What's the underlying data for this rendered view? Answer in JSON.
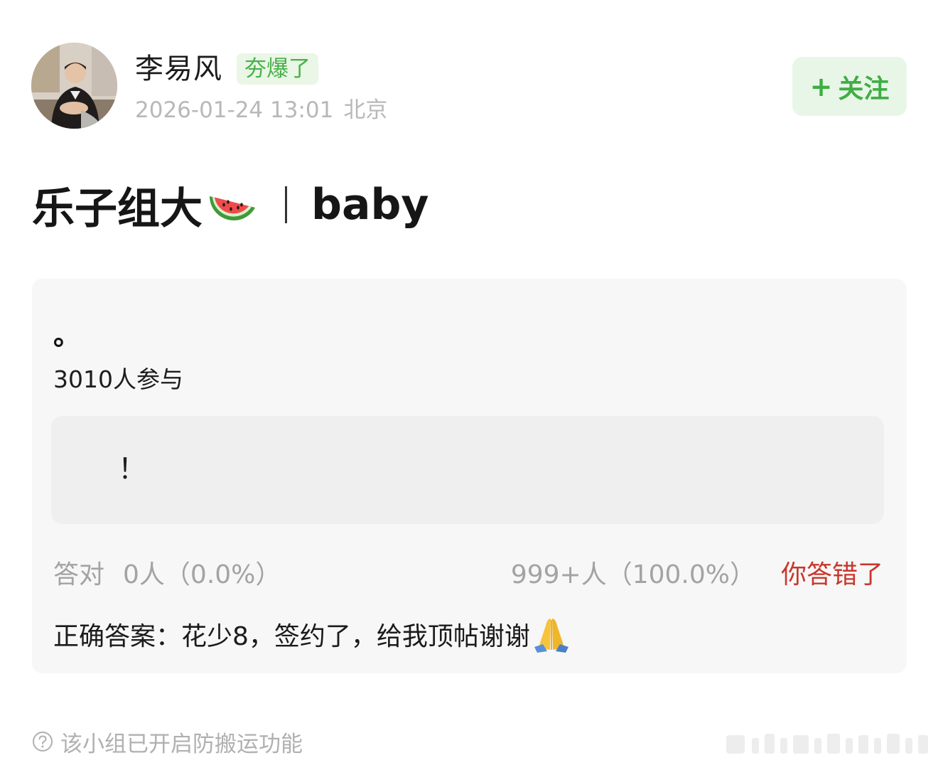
{
  "header": {
    "username": "李易风",
    "badge": "夯爆了",
    "date": "2026-01-24 13:01",
    "location": "北京",
    "follow_label": "关注",
    "follow_plus": "+"
  },
  "post": {
    "title_text": "乐子组大",
    "title_emoji": "watermelon-emoji",
    "title_suffix": "baby"
  },
  "quiz": {
    "question": "。",
    "participants": "3010人参与",
    "option": "！",
    "correct_label": "答对",
    "correct_count": "0人（0.0%）",
    "wrong_count": "999+人（100.0%）",
    "wrong_label": "你答错了",
    "answer": "正确答案：花少8，签约了，给我顶帖谢谢",
    "answer_emoji": "folded-hands-emoji"
  },
  "footer": {
    "note": "该小组已开启防搬运功能",
    "icon": "question-circle-icon"
  },
  "colors": {
    "accent_green": "#47b14a",
    "badge_bg": "#eaf6e6",
    "wrong_red": "#c8372d",
    "card_bg": "#f7f7f7",
    "option_bg": "#efefef"
  }
}
